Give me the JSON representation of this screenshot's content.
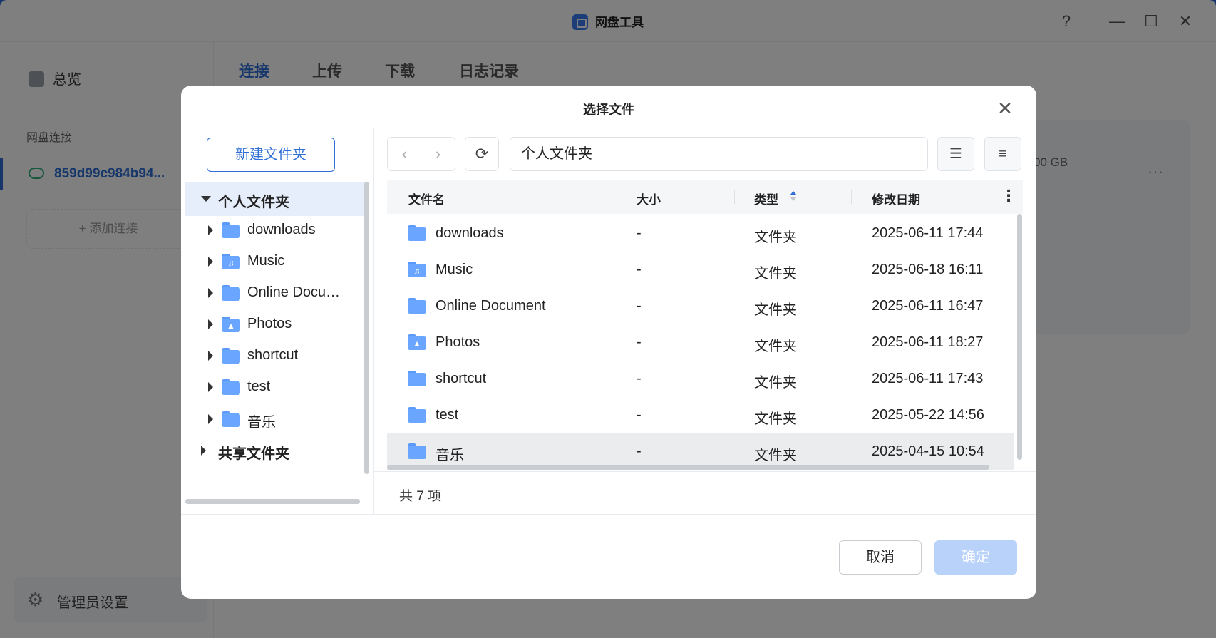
{
  "app": {
    "title": "网盘工具",
    "help": "?",
    "minimize": "—",
    "maximize": "☐",
    "close": "✕"
  },
  "sidebar": {
    "overview": "总览",
    "section_label": "网盘连接",
    "connection_name": "859d99c984b94...",
    "add_connection": "+ 添加连接",
    "admin_settings": "管理员设置"
  },
  "main": {
    "tabs": [
      {
        "label": "连接"
      },
      {
        "label": "上传"
      },
      {
        "label": "下载"
      },
      {
        "label": "日志记录"
      }
    ],
    "card_capacity": "00 GB",
    "card_more": "···"
  },
  "dialog": {
    "title": "选择文件",
    "new_folder": "新建文件夹",
    "path": "个人文件夹",
    "tree": {
      "root_personal": "个人文件夹",
      "children": [
        {
          "label": "downloads",
          "icon": "folder-icon"
        },
        {
          "label": "Music",
          "icon": "music-folder-icon"
        },
        {
          "label": "Online Docu…",
          "icon": "folder-icon"
        },
        {
          "label": "Photos",
          "icon": "photos-folder-icon"
        },
        {
          "label": "shortcut",
          "icon": "folder-icon"
        },
        {
          "label": "test",
          "icon": "folder-icon"
        },
        {
          "label": "音乐",
          "icon": "folder-icon"
        }
      ],
      "root_shared": "共享文件夹"
    },
    "columns": {
      "name": "文件名",
      "size": "大小",
      "type": "类型",
      "modified": "修改日期"
    },
    "rows": [
      {
        "name": "downloads",
        "size": "-",
        "type": "文件夹",
        "modified": "2025-06-11 17:44",
        "icon": "folder-icon"
      },
      {
        "name": "Music",
        "size": "-",
        "type": "文件夹",
        "modified": "2025-06-18 16:11",
        "icon": "music-folder-icon"
      },
      {
        "name": "Online Document",
        "size": "-",
        "type": "文件夹",
        "modified": "2025-06-11 16:47",
        "icon": "folder-icon"
      },
      {
        "name": "Photos",
        "size": "-",
        "type": "文件夹",
        "modified": "2025-06-11 18:27",
        "icon": "photos-folder-icon"
      },
      {
        "name": "shortcut",
        "size": "-",
        "type": "文件夹",
        "modified": "2025-06-11 17:43",
        "icon": "folder-icon"
      },
      {
        "name": "test",
        "size": "-",
        "type": "文件夹",
        "modified": "2025-05-22 14:56",
        "icon": "folder-icon"
      },
      {
        "name": "音乐",
        "size": "-",
        "type": "文件夹",
        "modified": "2025-04-15 10:54",
        "icon": "folder-icon"
      }
    ],
    "item_count": "共 7 项",
    "cancel": "取消",
    "confirm": "确定"
  },
  "colors": {
    "accent": "#2f6fd6",
    "folder": "#6aa6ff",
    "confirm_disabled": "#b9d2fa"
  }
}
